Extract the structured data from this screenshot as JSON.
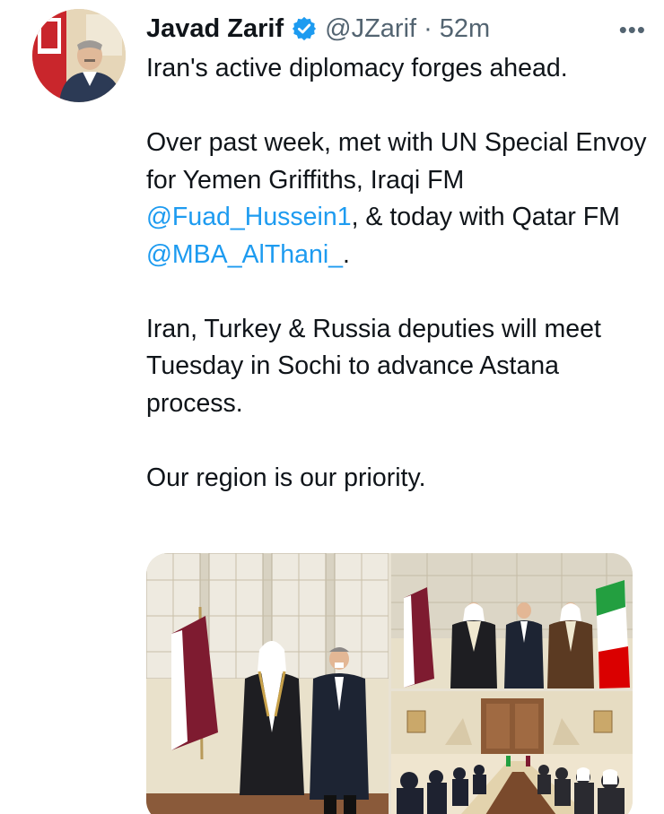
{
  "tweet": {
    "author": {
      "display_name": "Javad Zarif",
      "handle": "@JZarif",
      "verified": true,
      "avatar_icon": "profile-photo"
    },
    "separator": "·",
    "time": "52m",
    "more_icon": "more-horizontal-icon",
    "more_glyph": "•••",
    "paragraphs": [
      {
        "text": "Iran's active diplomacy forges ahead."
      },
      {
        "text_before": "Over past week, met with UN Special Envoy for Yemen Griffiths, Iraqi FM ",
        "mention_1": "@Fuad_Hussein1",
        "text_middle": ", & today with Qatar FM ",
        "mention_2": "@MBA_AlThani_",
        "text_after": "."
      },
      {
        "text": "Iran, Turkey & Russia deputies will meet Tuesday in Sochi to advance Astana process."
      },
      {
        "text": "Our region is our priority."
      }
    ],
    "media": {
      "count": 3,
      "photos": [
        {
          "description_icon": "photo-qatar-fm-meeting"
        },
        {
          "description_icon": "photo-group-with-flags"
        },
        {
          "description_icon": "photo-conference-table"
        }
      ]
    },
    "colors": {
      "text": "#0f1419",
      "secondary": "#536471",
      "link": "#1d9bf0",
      "verified": "#1d9bf0"
    }
  }
}
